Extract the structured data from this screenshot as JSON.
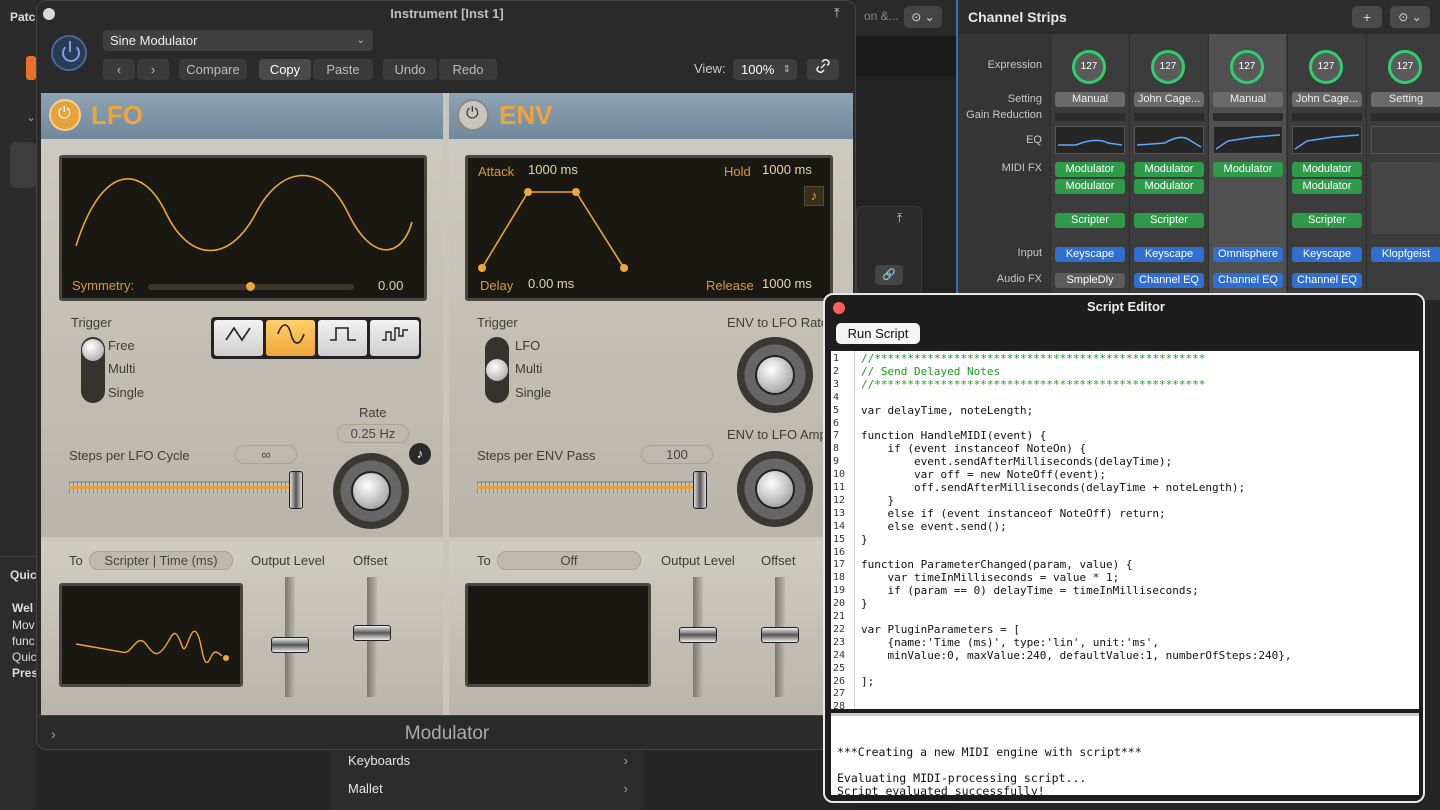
{
  "background": {
    "left_labels": [
      "Patc",
      "Quic",
      "Wel",
      "Mov",
      "func",
      "Quic",
      "Pres"
    ],
    "bottom_menu": [
      {
        "label": "Keyboards"
      },
      {
        "label": "Mallet"
      }
    ]
  },
  "channel_strips": {
    "title": "Channel Strips",
    "add_label": "+",
    "more_label": "⊙ ⌄",
    "row_labels": {
      "expression": "Expression",
      "setting": "Setting",
      "gain_reduction": "Gain Reduction",
      "eq": "EQ",
      "midi_fx": "MIDI FX",
      "input": "Input",
      "audio_fx": "Audio FX"
    },
    "strips": [
      {
        "expression": "127",
        "setting": "Manual",
        "midi_fx": [
          "Modulator",
          "Modulator",
          "",
          "Scripter"
        ],
        "input": "Keyscape",
        "audio_fx": "SmpleDly"
      },
      {
        "expression": "127",
        "setting": "John Cage...",
        "midi_fx": [
          "Modulator",
          "Modulator",
          "",
          "Scripter"
        ],
        "input": "Keyscape",
        "audio_fx": "Channel EQ"
      },
      {
        "expression": "127",
        "setting": "Manual",
        "midi_fx": [
          "Modulator"
        ],
        "input": "Omnisphere",
        "audio_fx": "Channel EQ"
      },
      {
        "expression": "127",
        "setting": "John Cage...",
        "midi_fx": [
          "Modulator",
          "Modulator",
          "",
          "Scripter"
        ],
        "input": "Keyscape",
        "audio_fx": "Channel EQ"
      },
      {
        "expression": "127",
        "setting": "Setting",
        "midi_fx": [],
        "input": "Klopfgeist",
        "audio_fx": ""
      }
    ]
  },
  "instrument": {
    "window_title": "Instrument [Inst 1]",
    "preset": "Sine Modulator",
    "toolbar": {
      "compare": "Compare",
      "copy": "Copy",
      "paste": "Paste",
      "undo": "Undo",
      "redo": "Redo",
      "view_label": "View:",
      "zoom": "100%"
    },
    "lfo": {
      "title": "LFO",
      "symmetry_label": "Symmetry:",
      "symmetry_value": "0.00",
      "trigger_label": "Trigger",
      "trigger_options": [
        "Free",
        "Multi",
        "Single"
      ],
      "rate_label": "Rate",
      "rate_value": "0.25 Hz",
      "steps_label": "Steps per LFO Cycle",
      "steps_value": "∞",
      "to_label": "To",
      "to_value": "Scripter | Time (ms)",
      "output_level_label": "Output Level",
      "offset_label": "Offset"
    },
    "env": {
      "title": "ENV",
      "attack_label": "Attack",
      "attack_value": "1000 ms",
      "hold_label": "Hold",
      "hold_value": "1000 ms",
      "delay_label": "Delay",
      "delay_value": "0.00 ms",
      "release_label": "Release",
      "release_value": "1000 ms",
      "trigger_label": "Trigger",
      "trigger_options": [
        "LFO",
        "Multi",
        "Single"
      ],
      "env_to_lfo_rate": "ENV to LFO Rate",
      "env_to_lfo_amp": "ENV to LFO Amp",
      "steps_label": "Steps per ENV Pass",
      "steps_value": "100",
      "to_label": "To",
      "to_value": "Off",
      "output_level_label": "Output Level",
      "offset_label": "Offset"
    },
    "footer_title": "Modulator"
  },
  "script_editor": {
    "title": "Script Editor",
    "run_label": "Run Script",
    "code_lines": [
      "//**************************************************",
      "// Send Delayed Notes",
      "//**************************************************",
      "",
      "var delayTime, noteLength;",
      "",
      "function HandleMIDI(event) {",
      "    if (event instanceof NoteOn) {",
      "        event.sendAfterMilliseconds(delayTime);",
      "        var off = new NoteOff(event);",
      "        off.sendAfterMilliseconds(delayTime + noteLength);",
      "    }",
      "    else if (event instanceof NoteOff) return;",
      "    else event.send();",
      "}",
      "",
      "function ParameterChanged(param, value) {",
      "    var timeInMilliseconds = value * 1;",
      "    if (param == 0) delayTime = timeInMilliseconds;",
      "}",
      "",
      "var PluginParameters = [",
      "    {name:'Time (ms)', type:'lin', unit:'ms',",
      "    minValue:0, maxValue:240, defaultValue:1, numberOfSteps:240},",
      "",
      "];",
      "",
      ""
    ],
    "console_lines": [
      "",
      "***Creating a new MIDI engine with script***",
      "",
      "Evaluating MIDI-processing script...",
      "Script evaluated successfully!"
    ]
  },
  "colors": {
    "accent_orange": "#f0a53a",
    "midi_green": "#2e9a4a",
    "blue": "#2f6fd0"
  }
}
